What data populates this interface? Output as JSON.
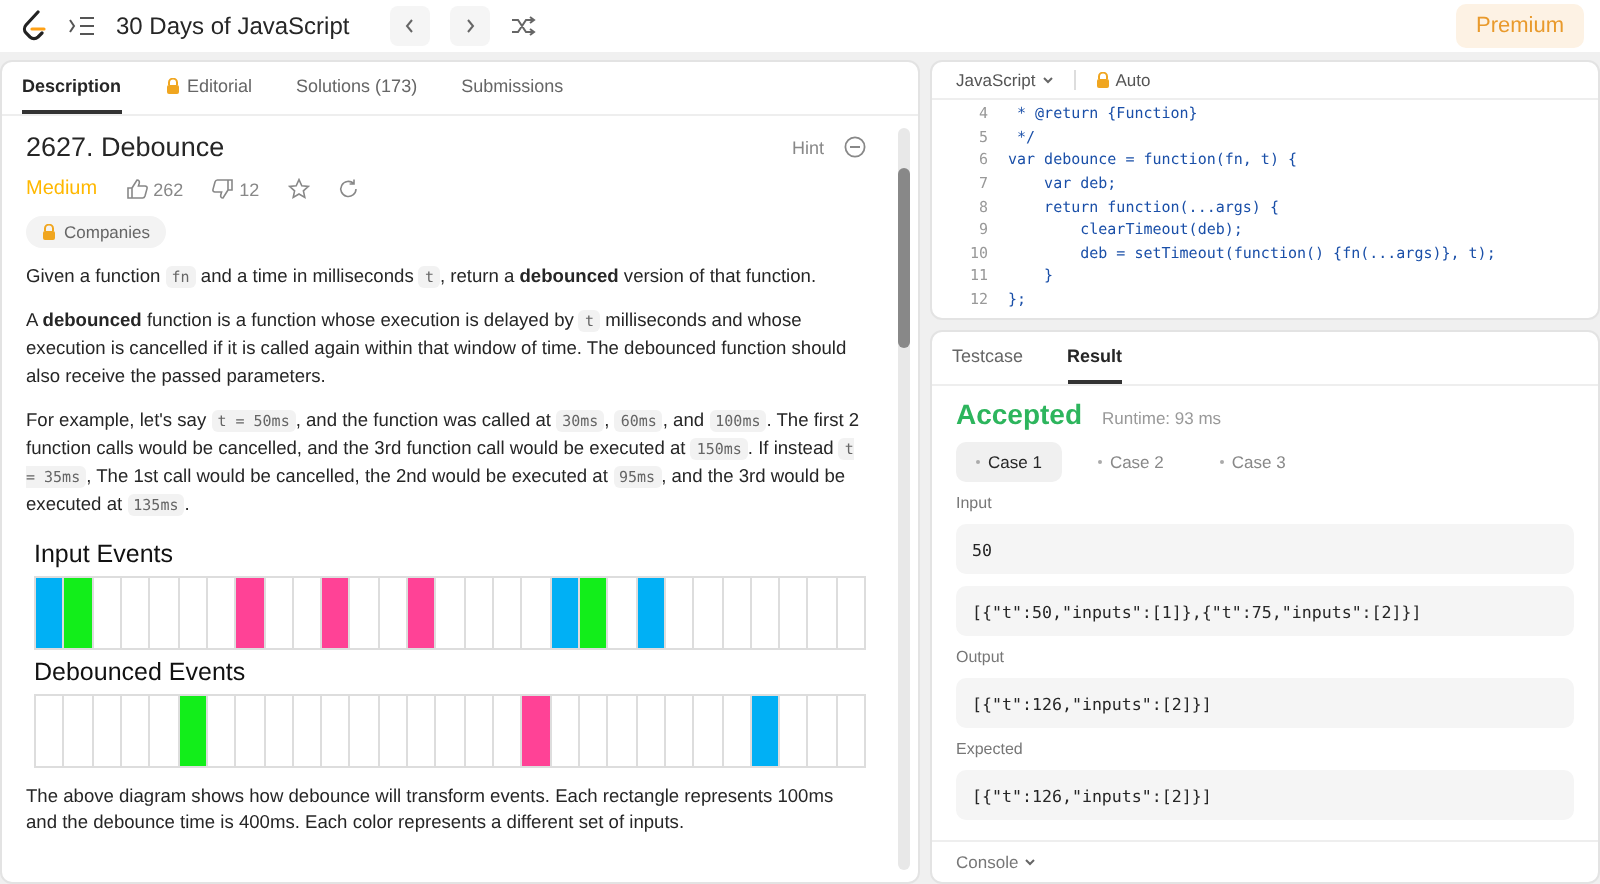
{
  "top_bar": {
    "title": "30 Days of JavaScript",
    "premium": "Premium"
  },
  "description_panel": {
    "tabs": [
      {
        "label": "Description",
        "selected": true,
        "locked": false
      },
      {
        "label": "Editorial",
        "selected": false,
        "locked": true
      },
      {
        "label": "Solutions (173)",
        "selected": false,
        "locked": false
      },
      {
        "label": "Submissions",
        "selected": false,
        "locked": false
      }
    ],
    "problem_title": "2627. Debounce",
    "hint": "Hint",
    "difficulty": "Medium",
    "likes": "262",
    "dislikes": "12",
    "companies": "Companies",
    "paragraphs": [
      [
        {
          "kind": "text",
          "text": "Given a function "
        },
        {
          "kind": "code",
          "text": "fn"
        },
        {
          "kind": "text",
          "text": " and a time in milliseconds "
        },
        {
          "kind": "code",
          "text": "t"
        },
        {
          "kind": "text",
          "text": ", return a "
        },
        {
          "kind": "bold",
          "text": "debounced"
        },
        {
          "kind": "text",
          "text": " version of that function."
        }
      ],
      [
        {
          "kind": "text",
          "text": "A "
        },
        {
          "kind": "bold",
          "text": "debounced"
        },
        {
          "kind": "text",
          "text": " function is a function whose execution is delayed by "
        },
        {
          "kind": "code",
          "text": "t"
        },
        {
          "kind": "text",
          "text": " milliseconds and whose execution is cancelled if it is called again within that window of time. The debounced function should also receive the passed parameters."
        }
      ],
      [
        {
          "kind": "text",
          "text": "For example, let's say "
        },
        {
          "kind": "code",
          "text": "t = 50ms"
        },
        {
          "kind": "text",
          "text": ", and the function was called at "
        },
        {
          "kind": "code",
          "text": "30ms"
        },
        {
          "kind": "text",
          "text": ", "
        },
        {
          "kind": "code",
          "text": "60ms"
        },
        {
          "kind": "text",
          "text": ", and "
        },
        {
          "kind": "code",
          "text": "100ms"
        },
        {
          "kind": "text",
          "text": ". The first 2 function calls would be cancelled, and the 3rd function call would be executed at "
        },
        {
          "kind": "code",
          "text": "150ms"
        },
        {
          "kind": "text",
          "text": ". If instead "
        },
        {
          "kind": "code",
          "text": "t = 35ms"
        },
        {
          "kind": "text",
          "text": ", The 1st call would be cancelled, the 2nd would be executed at "
        },
        {
          "kind": "code",
          "text": "95ms"
        },
        {
          "kind": "text",
          "text": ", and the 3rd would be executed at "
        },
        {
          "kind": "code",
          "text": "135ms"
        },
        {
          "kind": "text",
          "text": "."
        }
      ]
    ],
    "diagram": [
      {
        "title": "Input Events",
        "cells": [
          {
            "color": "#00b0f5"
          },
          {
            "color": "#12ee1a"
          },
          {
            "color": "#ffffff"
          },
          {
            "color": "#ffffff"
          },
          {
            "color": "#ffffff"
          },
          {
            "color": "#ffffff"
          },
          {
            "color": "#ffffff"
          },
          {
            "color": "#ff4296"
          },
          {
            "color": "#ffffff"
          },
          {
            "color": "#ffffff"
          },
          {
            "color": "#ff4296"
          },
          {
            "color": "#ffffff"
          },
          {
            "color": "#ffffff"
          },
          {
            "color": "#ff4296"
          },
          {
            "color": "#ffffff"
          },
          {
            "color": "#ffffff"
          },
          {
            "color": "#ffffff"
          },
          {
            "color": "#ffffff"
          },
          {
            "color": "#00b0f5"
          },
          {
            "color": "#12ee1a"
          },
          {
            "color": "#ffffff"
          },
          {
            "color": "#00b0f5"
          },
          {
            "color": "#ffffff"
          },
          {
            "color": "#ffffff"
          },
          {
            "color": "#ffffff"
          },
          {
            "color": "#ffffff"
          },
          {
            "color": "#ffffff"
          },
          {
            "color": "#ffffff"
          },
          {
            "color": "#ffffff"
          }
        ]
      },
      {
        "title": "Debounced Events",
        "cells": [
          {
            "color": "#ffffff"
          },
          {
            "color": "#ffffff"
          },
          {
            "color": "#ffffff"
          },
          {
            "color": "#ffffff"
          },
          {
            "color": "#ffffff"
          },
          {
            "color": "#12ee1a"
          },
          {
            "color": "#ffffff"
          },
          {
            "color": "#ffffff"
          },
          {
            "color": "#ffffff"
          },
          {
            "color": "#ffffff"
          },
          {
            "color": "#ffffff"
          },
          {
            "color": "#ffffff"
          },
          {
            "color": "#ffffff"
          },
          {
            "color": "#ffffff"
          },
          {
            "color": "#ffffff"
          },
          {
            "color": "#ffffff"
          },
          {
            "color": "#ffffff"
          },
          {
            "color": "#ff4296"
          },
          {
            "color": "#ffffff"
          },
          {
            "color": "#ffffff"
          },
          {
            "color": "#ffffff"
          },
          {
            "color": "#ffffff"
          },
          {
            "color": "#ffffff"
          },
          {
            "color": "#ffffff"
          },
          {
            "color": "#ffffff"
          },
          {
            "color": "#00b0f5"
          },
          {
            "color": "#ffffff"
          },
          {
            "color": "#ffffff"
          },
          {
            "color": "#ffffff"
          }
        ]
      }
    ],
    "after_diagram": "The above diagram shows how debounce will transform events. Each rectangle represents 100ms and the debounce time is 400ms. Each color represents a different set of inputs."
  },
  "editor": {
    "language": "JavaScript",
    "mode": "Auto",
    "lines": [
      {
        "number": "4",
        "code": " * @return {Function}"
      },
      {
        "number": "5",
        "code": " */"
      },
      {
        "number": "6",
        "code": "var debounce = function(fn, t) {"
      },
      {
        "number": "7",
        "code": "    var deb;"
      },
      {
        "number": "8",
        "code": "    return function(...args) {"
      },
      {
        "number": "9",
        "code": "        clearTimeout(deb);"
      },
      {
        "number": "10",
        "code": "        deb = setTimeout(function() {fn(...args)}, t);"
      },
      {
        "number": "11",
        "code": "    }"
      },
      {
        "number": "12",
        "code": "};"
      }
    ]
  },
  "result_panel": {
    "tabs": [
      {
        "label": "Testcase",
        "selected": false
      },
      {
        "label": "Result",
        "selected": true
      }
    ],
    "status": "Accepted",
    "runtime": "Runtime: 93 ms",
    "cases": [
      {
        "label": "Case 1",
        "selected": true
      },
      {
        "label": "Case 2",
        "selected": false
      },
      {
        "label": "Case 3",
        "selected": false
      }
    ],
    "sections": [
      {
        "label": "Input",
        "values": [
          "50",
          "[{\"t\":50,\"inputs\":[1]},{\"t\":75,\"inputs\":[2]}]"
        ]
      },
      {
        "label": "Output",
        "values": [
          "[{\"t\":126,\"inputs\":[2]}]"
        ]
      },
      {
        "label": "Expected",
        "values": [
          "[{\"t\":126,\"inputs\":[2]}]"
        ]
      }
    ],
    "console": "Console"
  }
}
